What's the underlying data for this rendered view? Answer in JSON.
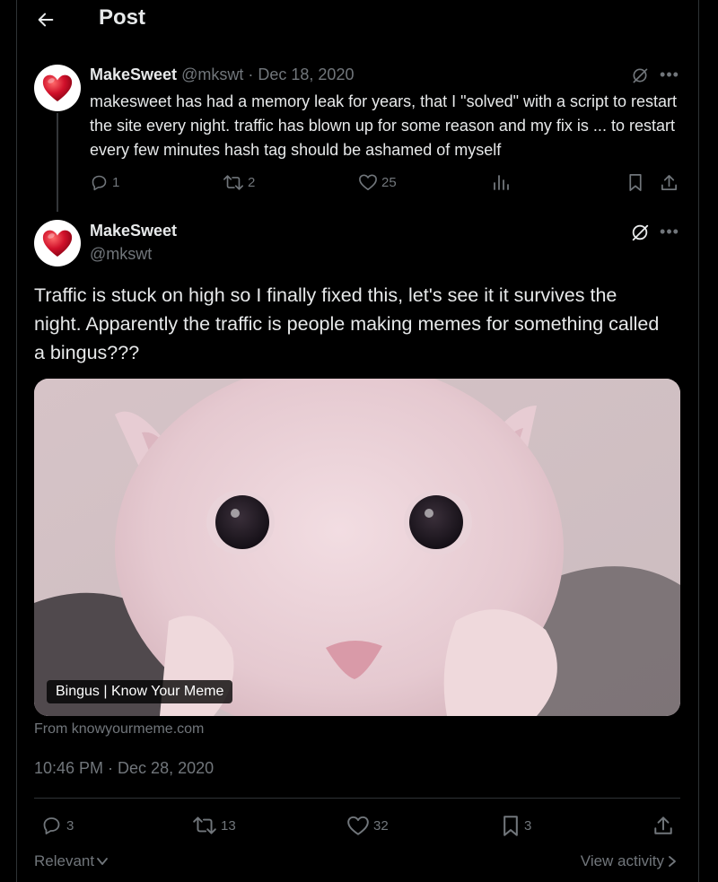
{
  "header": {
    "title": "Post"
  },
  "parent_tweet": {
    "name": "MakeSweet",
    "handle": "@mkswt",
    "separator": "·",
    "date": "Dec 18, 2020",
    "text": "makesweet has had a memory leak for years, that I \"solved\" with a script to restart the site every night. traffic has blown up for some reason and my fix is ... to restart every few minutes hash tag should be ashamed of myself",
    "replies": "1",
    "reposts": "2",
    "likes": "25"
  },
  "main_tweet": {
    "name": "MakeSweet",
    "handle": "@mkswt",
    "text": "Traffic is stuck on high so I finally fixed this, let's see it it survives the night. Apparently the traffic is people making memes for something called a bingus???",
    "card_label": "Bingus | Know Your Meme",
    "card_source": "From knowyourmeme.com",
    "timestamp": "10:46 PM · Dec 28, 2020",
    "replies": "3",
    "reposts": "13",
    "likes": "32",
    "bookmarks": "3"
  },
  "footer": {
    "sort_label": "Relevant",
    "view_activity": "View activity"
  },
  "colors": {
    "background": "#000000",
    "text": "#e7e9ea",
    "muted": "#71767b",
    "border": "#2f3336",
    "avatar_heart": "#c8102e"
  },
  "icons": [
    "back-arrow-icon",
    "heart-avatar-icon",
    "grok-icon",
    "more-icon",
    "reply-icon",
    "repost-icon",
    "like-icon",
    "views-icon",
    "bookmark-icon",
    "share-icon",
    "chevron-down-icon",
    "chevron-right-icon"
  ]
}
